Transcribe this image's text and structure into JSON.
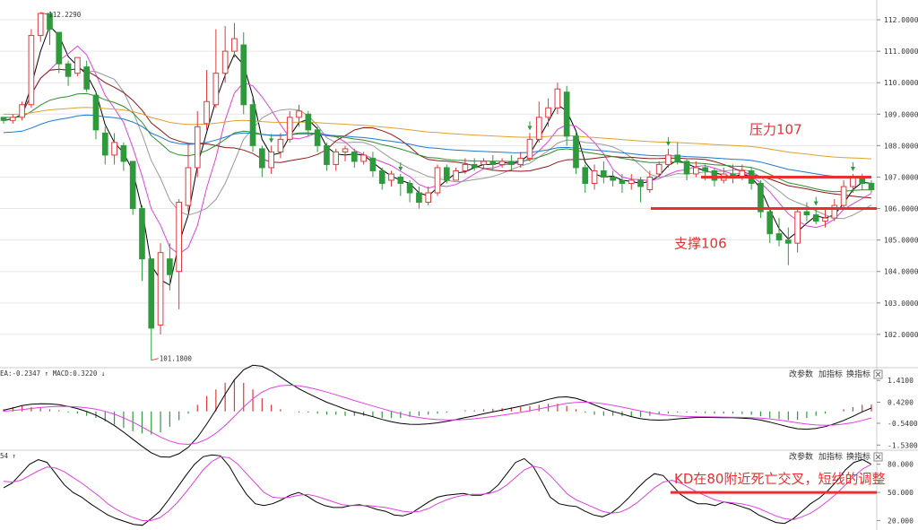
{
  "colors": {
    "up": "#e0393a",
    "down": "#2e9a3c",
    "ma_short": "#000000",
    "ma_mid": "#e040e0",
    "ma3": "#999999",
    "ma4": "#8b1a1a",
    "ma5": "#2e8b2e",
    "ma6": "#1e78d0",
    "ma7": "#e0a030",
    "annotation": "#e83030",
    "grid": "#e6e6e6",
    "axis": "#cccccc"
  },
  "main_panel": {
    "high_label": "112.2290",
    "low_label": "101.1800",
    "y_ticks": [
      "112.0000",
      "111.0000",
      "110.0000",
      "109.0000",
      "108.0000",
      "107.0000",
      "106.0000",
      "105.0000",
      "104.0000",
      "103.0000",
      "102.0000"
    ],
    "resistance_label": "压力107",
    "support_label": "支撑106"
  },
  "macd_panel": {
    "header": "EA:-0.2347 ↑ MACD:0.3220 ↓",
    "y_ticks": [
      "1.4100",
      "0.4200",
      "-0.5400",
      "-1.5300"
    ],
    "buttons": [
      "改参数",
      "加指标",
      "换指标"
    ]
  },
  "kd_panel": {
    "header": "54 ↑",
    "y_ticks": [
      "80.000",
      "50.000",
      "20.000"
    ],
    "buttons": [
      "改参数",
      "加指标",
      "换指标"
    ],
    "annotation": "KD在80附近死亡交叉，短线的调整"
  },
  "chart_data": [
    {
      "type": "candlestick",
      "title": "",
      "ylim": [
        101.0,
        112.4
      ],
      "note": "approximate daily OHLC read from price axis",
      "candles": [
        [
          108.9,
          108.8,
          108.9,
          108.7
        ],
        [
          108.8,
          108.9,
          109.0,
          108.7
        ],
        [
          108.9,
          109.3,
          109.4,
          108.8
        ],
        [
          109.3,
          111.5,
          111.7,
          109.2
        ],
        [
          111.5,
          112.2,
          112.23,
          111.3
        ],
        [
          112.2,
          111.7,
          112.1,
          111.2
        ],
        [
          111.6,
          110.6,
          111.6,
          110.3
        ],
        [
          110.6,
          110.2,
          110.7,
          109.9
        ],
        [
          110.3,
          110.8,
          110.8,
          110.2
        ],
        [
          110.5,
          109.8,
          110.7,
          109.7
        ],
        [
          109.6,
          108.5,
          109.7,
          108.2
        ],
        [
          108.4,
          107.7,
          108.6,
          107.4
        ],
        [
          107.7,
          108.1,
          108.4,
          107.4
        ],
        [
          108.0,
          107.5,
          108.1,
          107.2
        ],
        [
          107.5,
          106.0,
          107.5,
          105.8
        ],
        [
          106.0,
          104.4,
          106.1,
          103.7
        ],
        [
          104.4,
          102.2,
          104.4,
          101.18
        ],
        [
          102.3,
          104.6,
          104.9,
          102.0
        ],
        [
          104.4,
          103.9,
          104.9,
          103.4
        ],
        [
          104.0,
          106.2,
          106.3,
          102.8
        ],
        [
          106.1,
          107.3,
          108.1,
          105.9
        ],
        [
          107.3,
          108.6,
          109.1,
          107.0
        ],
        [
          108.7,
          109.4,
          110.4,
          108.5
        ],
        [
          109.3,
          110.3,
          111.7,
          109.2
        ],
        [
          110.3,
          111.0,
          111.8,
          110.0
        ],
        [
          111.0,
          111.4,
          111.9,
          110.8
        ],
        [
          111.2,
          109.3,
          111.6,
          109.0
        ],
        [
          109.3,
          108.0,
          109.5,
          107.8
        ],
        [
          107.9,
          107.3,
          108.0,
          107.0
        ],
        [
          107.3,
          107.8,
          108.0,
          107.1
        ],
        [
          107.8,
          108.2,
          108.4,
          107.6
        ],
        [
          108.2,
          108.9,
          109.1,
          108.1
        ],
        [
          108.9,
          109.1,
          109.3,
          108.6
        ],
        [
          109.0,
          108.5,
          109.1,
          108.3
        ],
        [
          108.5,
          108.0,
          108.6,
          107.8
        ],
        [
          108.0,
          107.4,
          108.1,
          107.2
        ],
        [
          107.4,
          107.8,
          107.9,
          107.2
        ],
        [
          107.8,
          107.9,
          108.0,
          107.5
        ],
        [
          107.8,
          107.5,
          107.9,
          107.3
        ],
        [
          107.5,
          107.7,
          107.8,
          107.4
        ],
        [
          107.6,
          107.2,
          107.8,
          107.0
        ],
        [
          107.2,
          106.8,
          107.3,
          106.6
        ],
        [
          106.9,
          107.1,
          107.2,
          106.7
        ],
        [
          107.0,
          106.8,
          107.1,
          106.4
        ],
        [
          106.8,
          106.5,
          106.9,
          106.2
        ],
        [
          106.5,
          106.2,
          106.7,
          106.0
        ],
        [
          106.2,
          106.5,
          106.7,
          106.1
        ],
        [
          106.5,
          107.3,
          107.4,
          106.4
        ],
        [
          107.3,
          106.9,
          107.4,
          106.8
        ],
        [
          106.9,
          107.2,
          107.3,
          106.9
        ],
        [
          107.2,
          107.4,
          107.6,
          107.1
        ],
        [
          107.4,
          107.3,
          107.6,
          107.2
        ],
        [
          107.4,
          107.5,
          107.6,
          107.3
        ],
        [
          107.5,
          107.4,
          107.7,
          107.2
        ],
        [
          107.4,
          107.5,
          107.6,
          107.3
        ],
        [
          107.5,
          107.4,
          107.7,
          107.2
        ],
        [
          107.4,
          107.6,
          107.8,
          107.3
        ],
        [
          107.6,
          108.2,
          108.4,
          107.5
        ],
        [
          108.2,
          108.9,
          109.4,
          108.1
        ],
        [
          108.9,
          109.2,
          109.5,
          108.6
        ],
        [
          109.2,
          109.8,
          110.0,
          109.0
        ],
        [
          109.7,
          108.3,
          109.9,
          108.0
        ],
        [
          108.3,
          107.3,
          108.4,
          107.1
        ],
        [
          107.3,
          106.8,
          107.4,
          106.5
        ],
        [
          106.8,
          107.2,
          107.4,
          106.6
        ],
        [
          107.2,
          107.0,
          107.5,
          106.8
        ],
        [
          107.0,
          106.9,
          107.2,
          106.7
        ],
        [
          106.9,
          106.8,
          107.1,
          106.5
        ],
        [
          106.8,
          106.9,
          107.1,
          106.6
        ],
        [
          106.9,
          106.7,
          107.0,
          106.2
        ],
        [
          106.6,
          107.0,
          107.2,
          106.5
        ],
        [
          107.1,
          107.4,
          107.5,
          107.0
        ],
        [
          107.4,
          107.7,
          107.9,
          107.3
        ],
        [
          107.7,
          107.5,
          108.1,
          107.4
        ],
        [
          107.5,
          107.1,
          107.6,
          106.9
        ],
        [
          107.1,
          107.3,
          107.5,
          107.0
        ],
        [
          107.3,
          107.2,
          107.4,
          106.9
        ],
        [
          107.2,
          106.9,
          107.3,
          106.7
        ],
        [
          106.9,
          107.1,
          107.3,
          106.8
        ],
        [
          107.1,
          107.0,
          107.4,
          106.8
        ],
        [
          107.0,
          107.2,
          107.4,
          106.9
        ],
        [
          107.2,
          106.8,
          107.3,
          106.6
        ],
        [
          106.8,
          105.9,
          106.9,
          105.7
        ],
        [
          105.9,
          105.2,
          106.0,
          104.9
        ],
        [
          105.2,
          105.0,
          105.7,
          104.8
        ],
        [
          105.0,
          104.9,
          105.4,
          104.2
        ],
        [
          104.9,
          105.9,
          106.0,
          104.6
        ],
        [
          105.9,
          105.8,
          106.2,
          105.6
        ],
        [
          105.8,
          105.6,
          106.0,
          105.5
        ],
        [
          105.6,
          105.7,
          106.0,
          105.4
        ],
        [
          105.7,
          106.1,
          106.3,
          105.6
        ],
        [
          106.1,
          106.7,
          106.9,
          106.0
        ],
        [
          106.7,
          107.0,
          107.1,
          106.5
        ],
        [
          107.0,
          106.8,
          107.1,
          106.6
        ],
        [
          106.8,
          106.6,
          106.9,
          106.5
        ]
      ],
      "annotation_lines": [
        {
          "label": "压力107",
          "y": 107.0
        },
        {
          "label": "支撑106",
          "y": 106.0
        }
      ]
    },
    {
      "type": "bar",
      "title": "MACD",
      "ylim": [
        -1.6,
        1.5
      ],
      "series": [
        {
          "name": "MACD",
          "values": [
            0.1,
            0.2,
            0.25,
            0.2,
            0.15,
            0.1,
            0.05,
            -0.05,
            -0.1,
            -0.2,
            -0.3,
            -0.45,
            -0.6,
            -0.75,
            -0.9,
            -1.0,
            -1.05,
            -0.95,
            -0.7,
            -0.4,
            -0.1,
            0.3,
            0.7,
            1.0,
            1.3,
            1.45,
            1.3,
            1.0,
            0.6,
            0.3,
            0.1,
            0.0,
            -0.05,
            -0.05,
            -0.1,
            -0.15,
            -0.15,
            -0.2,
            -0.2,
            -0.2,
            -0.25,
            -0.3,
            -0.3,
            -0.3,
            -0.25,
            -0.2,
            -0.15,
            -0.1,
            -0.05,
            0.0,
            0.05,
            0.05,
            0.1,
            0.12,
            0.15,
            0.18,
            0.2,
            0.25,
            0.3,
            0.35,
            0.35,
            0.25,
            0.1,
            -0.05,
            -0.15,
            -0.2,
            -0.2,
            -0.22,
            -0.25,
            -0.25,
            -0.2,
            -0.15,
            -0.1,
            -0.05,
            -0.05,
            -0.05,
            -0.08,
            -0.1,
            -0.1,
            -0.1,
            -0.12,
            -0.15,
            -0.22,
            -0.3,
            -0.35,
            -0.4,
            -0.38,
            -0.3,
            -0.2,
            -0.1,
            0.0,
            0.1,
            0.2,
            0.3,
            0.32
          ]
        }
      ]
    },
    {
      "type": "line",
      "title": "KD",
      "ylim": [
        10,
        95
      ],
      "series": [
        {
          "name": "K",
          "values": [
            55,
            60,
            70,
            80,
            85,
            82,
            70,
            58,
            50,
            45,
            38,
            32,
            26,
            22,
            19,
            16,
            15,
            22,
            30,
            42,
            55,
            68,
            80,
            88,
            90,
            89,
            78,
            62,
            48,
            38,
            36,
            38,
            42,
            47,
            50,
            46,
            40,
            36,
            34,
            34,
            36,
            37,
            35,
            32,
            30,
            26,
            25,
            28,
            34,
            40,
            45,
            47,
            48,
            49,
            47,
            47,
            50,
            58,
            70,
            82,
            86,
            78,
            62,
            45,
            38,
            36,
            35,
            30,
            26,
            24,
            28,
            35,
            44,
            54,
            63,
            70,
            68,
            58,
            48,
            42,
            38,
            38,
            36,
            40,
            38,
            35,
            32,
            26,
            22,
            18,
            17,
            22,
            30,
            38,
            44,
            52,
            62,
            74,
            82,
            85,
            80
          ]
        },
        {
          "name": "D",
          "values": [
            62,
            61,
            63,
            68,
            73,
            77,
            76,
            72,
            66,
            60,
            53,
            46,
            38,
            32,
            27,
            23,
            20,
            20,
            23,
            30,
            39,
            50,
            62,
            74,
            83,
            88,
            87,
            80,
            70,
            60,
            50,
            45,
            44,
            45,
            47,
            48,
            46,
            43,
            40,
            37,
            36,
            36,
            36,
            35,
            34,
            32,
            30,
            29,
            30,
            33,
            38,
            42,
            45,
            47,
            48,
            48,
            49,
            52,
            58,
            66,
            74,
            78,
            76,
            68,
            58,
            48,
            42,
            38,
            34,
            30,
            28,
            29,
            33,
            39,
            47,
            55,
            61,
            63,
            60,
            55,
            50,
            46,
            42,
            40,
            39,
            38,
            36,
            33,
            29,
            25,
            22,
            21,
            24,
            28,
            34,
            41,
            49,
            58,
            67,
            75,
            80
          ]
        }
      ],
      "annotation": {
        "label": "KD在80附近死亡交叉，短线的调整",
        "y": 50
      }
    }
  ]
}
